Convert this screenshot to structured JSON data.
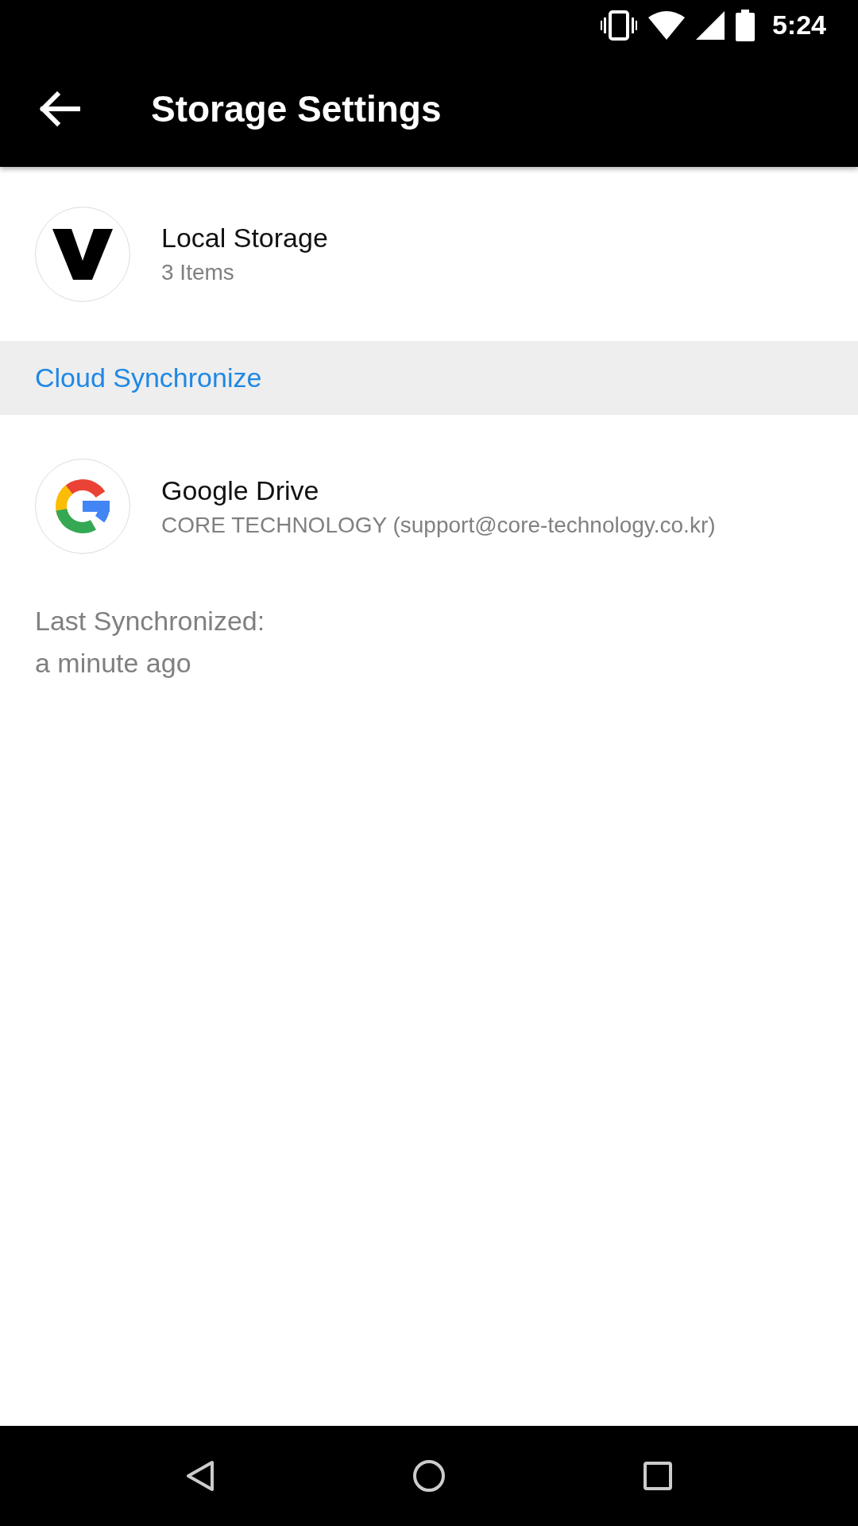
{
  "status_bar": {
    "time": "5:24"
  },
  "toolbar": {
    "title": "Storage Settings"
  },
  "local_storage": {
    "title": "Local Storage",
    "subtitle": "3 Items"
  },
  "section_header": "Cloud Synchronize",
  "accounts": [
    {
      "title": "Google Drive",
      "subtitle": "CORE TECHNOLOGY (support@core-technology.co.kr)"
    }
  ],
  "last_synchronized": {
    "label": "Last Synchronized:",
    "value": "a minute ago"
  }
}
